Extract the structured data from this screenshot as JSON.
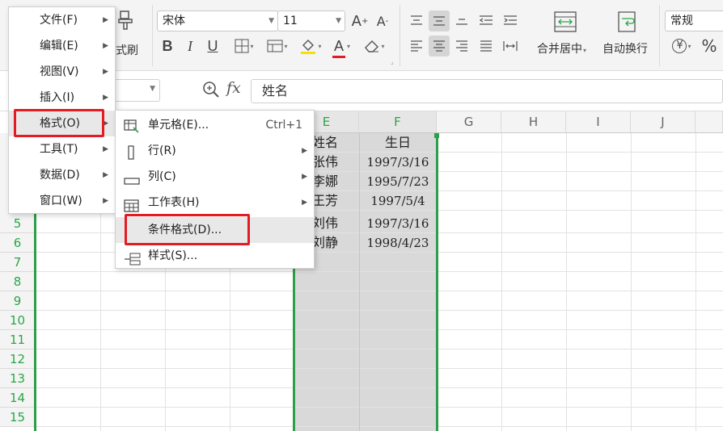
{
  "toolbar": {
    "format_painter_label": "式刷",
    "font_name": "宋体",
    "font_size": "11",
    "bold": "B",
    "italic": "I",
    "underline": "U",
    "font_color_glyph": "A",
    "merge_center_label": "合并居中",
    "wrap_text_label": "自动换行",
    "number_format": "常规",
    "percent_glyph": "%",
    "yen_glyph": "¥",
    "colors": {
      "accent_red": "#e41b23",
      "fill_yellow": "#f3e300",
      "font_red": "#e41b23"
    }
  },
  "formula_bar": {
    "fx_label": "fx",
    "content": "姓名"
  },
  "main_menu": {
    "items": [
      {
        "label": "文件(F)"
      },
      {
        "label": "编辑(E)"
      },
      {
        "label": "视图(V)"
      },
      {
        "label": "插入(I)"
      },
      {
        "label": "格式(O)"
      },
      {
        "label": "工具(T)"
      },
      {
        "label": "数据(D)"
      },
      {
        "label": "窗口(W)"
      }
    ]
  },
  "format_menu": {
    "items": [
      {
        "label": "单元格(E)...",
        "shortcut": "Ctrl+1"
      },
      {
        "label": "行(R)"
      },
      {
        "label": "列(C)"
      },
      {
        "label": "工作表(H)"
      },
      {
        "label": "条件格式(D)..."
      },
      {
        "label": "样式(S)..."
      }
    ]
  },
  "sheet": {
    "columns": [
      "E",
      "F",
      "G",
      "H",
      "I",
      "J"
    ],
    "rows": [
      "5",
      "6",
      "7",
      "8",
      "9",
      "10",
      "11",
      "12",
      "13",
      "14",
      "15"
    ],
    "data": [
      [
        "姓名",
        "生日"
      ],
      [
        "张伟",
        "1997/3/16"
      ],
      [
        "李娜",
        "1995/7/23"
      ],
      [
        "王芳",
        "1997/5/4"
      ],
      [
        "刘伟",
        "1997/3/16"
      ],
      [
        "刘静",
        "1998/4/23"
      ]
    ]
  }
}
